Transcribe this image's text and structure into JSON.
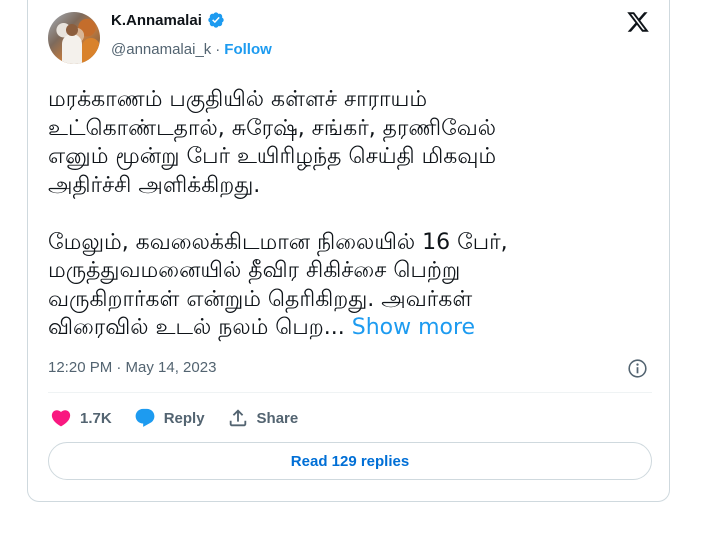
{
  "author": {
    "name": "K.Annamalai",
    "handle": "@annamalai_k",
    "separator": "·",
    "follow_label": "Follow"
  },
  "tweet": {
    "paragraph1": "மரக்காணம் பகுதியில் கள்ளச் சாராயம்\nஉட்கொண்டதால், சுரேஷ், சங்கர், தரணிவேல்\nஎனும் மூன்று பேர் உயிரிழந்த செய்தி மிகவும்\nஅதிர்ச்சி அளிக்கிறது.",
    "paragraph2": "மேலும், கவலைக்கிடமான நிலையில் 16 பேர்,\nமருத்துவமனையில் தீவிர சிகிச்சை பெற்று\nவருகிறார்கள் என்றும் தெரிகிறது. அவர்கள்\nவிரைவில் உடல் நலம் பெற...",
    "show_more": "Show more",
    "timestamp": "12:20 PM · May 14, 2023"
  },
  "actions": {
    "like_count": "1.7K",
    "reply_label": "Reply",
    "share_label": "Share",
    "read_replies": "Read 129 replies"
  },
  "colors": {
    "accent": "#1d9bf0",
    "like": "#f91880",
    "text": "#0f1419",
    "secondary": "#536471"
  },
  "icons": [
    "verified-icon",
    "x-logo-icon",
    "info-icon",
    "heart-icon",
    "reply-bubble-icon",
    "share-icon"
  ]
}
